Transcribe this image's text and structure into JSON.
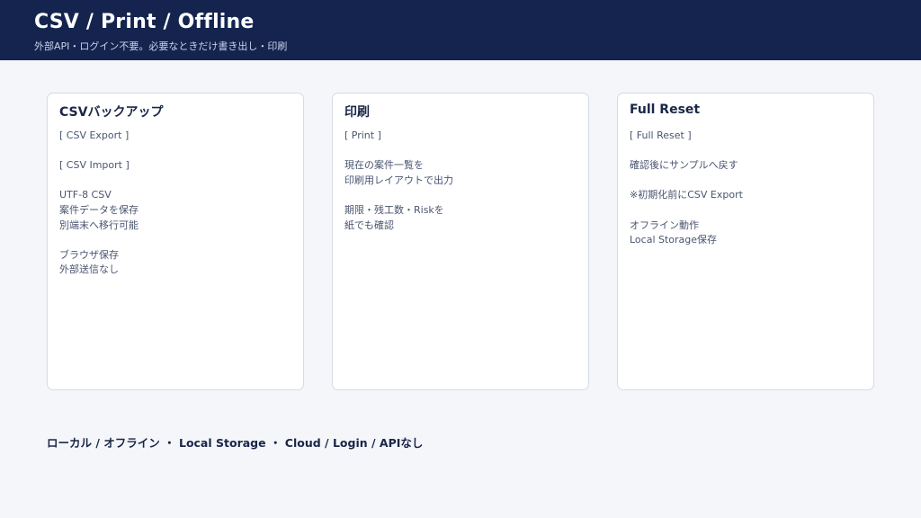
{
  "header": {
    "title": "CSV / Print / Offline",
    "subtitle": "外部API・ログイン不要。必要なときだけ書き出し・印刷"
  },
  "cards": [
    {
      "title": "CSVバックアップ",
      "lines": [
        "[ CSV Export ]",
        "",
        "[ CSV Import ]",
        "",
        "UTF-8 CSV",
        "案件データを保存",
        "別端末へ移行可能",
        "",
        "ブラウザ保存",
        "外部送信なし"
      ]
    },
    {
      "title": "印刷",
      "lines": [
        "[ Print ]",
        "",
        "現在の案件一覧を",
        "印刷用レイアウトで出力",
        "",
        "期限・残工数・Riskを",
        "紙でも確認"
      ]
    },
    {
      "title": "Full Reset",
      "lines": [
        "[ Full Reset ]",
        "",
        "確認後にサンプルへ戻す",
        "",
        "※初期化前にCSV Export",
        "",
        "オフライン動作",
        "Local Storage保存"
      ]
    }
  ],
  "footer": {
    "text": "ローカル / オフライン ・ Local Storage ・ Cloud / Login / APIなし"
  }
}
